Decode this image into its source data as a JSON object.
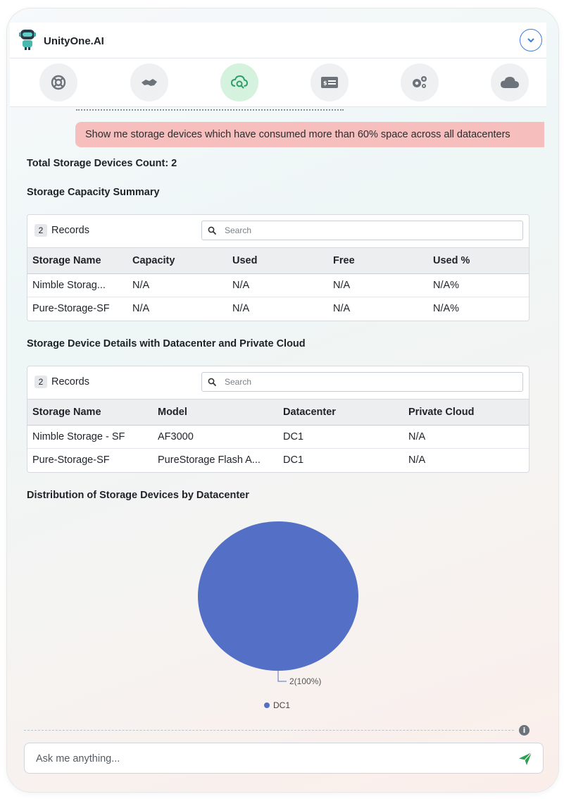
{
  "app": {
    "title": "UnityOne.AI",
    "collapse_icon": "chevron-down-icon",
    "accent_color": "#3d7be0"
  },
  "toolbar": {
    "items": [
      {
        "icon": "lifebuoy-icon",
        "active": false
      },
      {
        "icon": "handshake-icon",
        "active": false
      },
      {
        "icon": "cloud-search-icon",
        "active": true
      },
      {
        "icon": "billing-card-icon",
        "active": false
      },
      {
        "icon": "gears-icon",
        "active": false
      },
      {
        "icon": "cloud-icon",
        "active": false
      }
    ],
    "active_color": "#d4f2dd"
  },
  "conversation": {
    "user_prompt": "Show me storage devices which have consumed more than 60% space across all datacenters",
    "prompt_bg_color": "#f6bfbe",
    "total_count": "Total Storage Devices Count: 2",
    "summary_heading": "Storage Capacity Summary",
    "details_heading": "Storage Device Details with Datacenter and Private Cloud",
    "chart_heading": "Distribution of Storage Devices by Datacenter"
  },
  "capacity_table": {
    "records_count": "2",
    "records_label": "Records",
    "search_placeholder": "Search",
    "columns": [
      "Storage Name",
      "Capacity",
      "Used",
      "Free",
      "Used %"
    ],
    "rows": [
      [
        "Nimble Storag...",
        "N/A",
        "N/A",
        "N/A",
        "N/A%"
      ],
      [
        "Pure-Storage-SF",
        "N/A",
        "N/A",
        "N/A",
        "N/A%"
      ]
    ]
  },
  "details_table": {
    "records_count": "2",
    "records_label": "Records",
    "search_placeholder": "Search",
    "columns": [
      "Storage Name",
      "Model",
      "Datacenter",
      "Private Cloud"
    ],
    "rows": [
      [
        "Nimble Storage - SF",
        "AF3000",
        "DC1",
        "N/A"
      ],
      [
        "Pure-Storage-SF",
        "PureStorage Flash A...",
        "DC1",
        "N/A"
      ]
    ]
  },
  "chart_data": {
    "type": "pie",
    "categories": [
      "DC1"
    ],
    "values": [
      2
    ],
    "data_labels": [
      "2(100%)"
    ],
    "legend": [
      "DC1"
    ],
    "legend_position": "bottom",
    "colors": [
      "#5470c6"
    ]
  },
  "chat_input": {
    "placeholder": "Ask me anything...",
    "send_color": "#2e9e4f"
  }
}
